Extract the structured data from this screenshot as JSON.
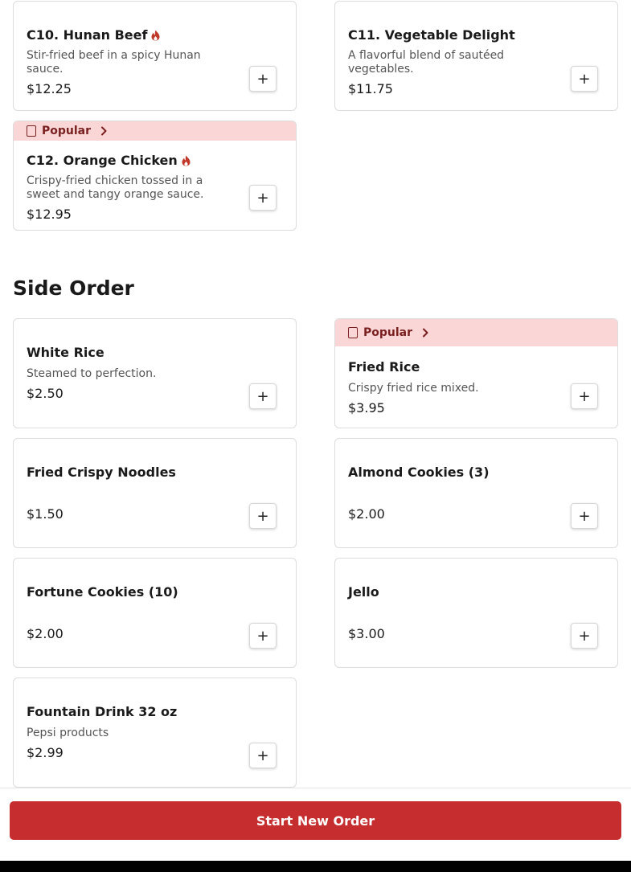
{
  "colors": {
    "accent": "#c62d2f",
    "popular_bg": "#fbd6d6",
    "popular_text": "#7a1f1f",
    "spicy_icon": "#c0392b"
  },
  "add_label": "+",
  "popular_label": "Popular",
  "top_items": [
    {
      "name": "C10. Hunan Beef",
      "spicy": true,
      "desc": "Stir-fried beef in a spicy Hunan sauce.",
      "price": "$12.25"
    },
    {
      "name": "C11. Vegetable Delight",
      "spicy": false,
      "desc": "A flavorful blend of sautéed vegetables.",
      "price": "$11.75"
    },
    {
      "name": "C12. Orange Chicken",
      "spicy": true,
      "popular": true,
      "desc": "Crispy-fried chicken tossed in a sweet and tangy orange sauce.",
      "price": "$12.95"
    }
  ],
  "side_order": {
    "title": "Side Order",
    "items": [
      {
        "name": "White Rice",
        "desc": "Steamed to perfection.",
        "price": "$2.50"
      },
      {
        "name": "Fried Rice",
        "popular": true,
        "desc": "Crispy fried rice mixed.",
        "price": "$3.95"
      },
      {
        "name": "Fried Crispy Noodles",
        "desc": "",
        "price": "$1.50"
      },
      {
        "name": "Almond Cookies (3)",
        "desc": "",
        "price": "$2.00"
      },
      {
        "name": "Fortune Cookies (10)",
        "desc": "",
        "price": "$2.00"
      },
      {
        "name": "Jello",
        "desc": "",
        "price": "$3.00"
      },
      {
        "name": "Fountain Drink 32 oz",
        "desc": "Pepsi products",
        "price": "$2.99"
      }
    ]
  },
  "footer": {
    "start_new_order": "Start New Order"
  }
}
